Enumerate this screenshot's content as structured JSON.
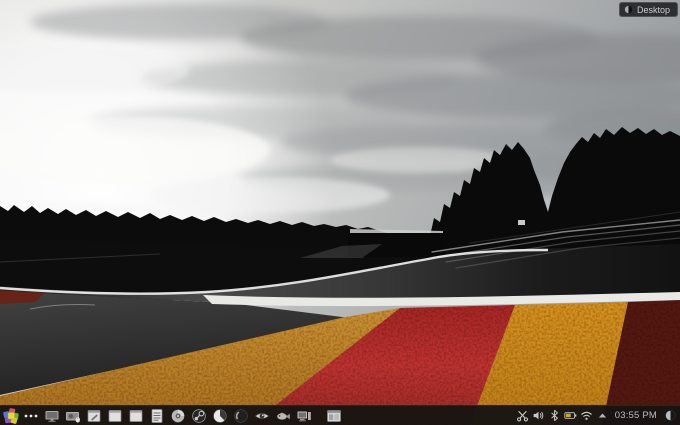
{
  "desktop_button": {
    "label": "Desktop",
    "icon": "sphere",
    "name": "desktop-toolbox-button"
  },
  "taskbar": {
    "launcher": {
      "name": "app-launcher-menu",
      "icon": "pinwheel"
    },
    "overflow": {
      "name": "overflow-menu",
      "icon": "dots"
    },
    "apps": [
      {
        "name": "display-app",
        "icon": "monitor"
      },
      {
        "name": "screen-recorder-app",
        "icon": "recorder"
      },
      {
        "name": "notes-app",
        "icon": "window-pencil"
      },
      {
        "name": "window-app-1",
        "icon": "window"
      },
      {
        "name": "window-app-2",
        "icon": "window"
      },
      {
        "name": "text-editor-app",
        "icon": "document"
      },
      {
        "name": "disc-burner-app",
        "icon": "disc"
      },
      {
        "name": "steam-app",
        "icon": "steam"
      },
      {
        "name": "browser-app",
        "icon": "globe-half"
      },
      {
        "name": "dark-browser-app",
        "icon": "dark-circle"
      },
      {
        "name": "media-viewer-app",
        "icon": "eye"
      },
      {
        "name": "fish-app",
        "icon": "fish"
      },
      {
        "name": "system-monitor-app",
        "icon": "computer"
      },
      {
        "name": "settings-app",
        "icon": "window-panels",
        "gap": "true"
      }
    ],
    "tray": [
      {
        "name": "clipboard-tray-icon",
        "icon": "scissors"
      },
      {
        "name": "volume-tray-icon",
        "icon": "speaker"
      },
      {
        "name": "bluetooth-tray-icon",
        "icon": "bluetooth"
      },
      {
        "name": "battery-tray-icon",
        "icon": "battery",
        "wide": "wide"
      },
      {
        "name": "network-tray-icon",
        "icon": "wifi"
      },
      {
        "name": "tray-expander-icon",
        "icon": "arrow-up",
        "wide": "tiny"
      }
    ],
    "clock": "03:55 PM",
    "toolbox": {
      "name": "panel-toolbox",
      "icon": "cashew"
    }
  },
  "colors": {
    "panel_bg": "#181512",
    "battery_fill": "#d6a51d",
    "kerb_red": "#b22a28",
    "kerb_yellow": "#d8921f",
    "kerb_orange": "#c98a2e",
    "kerb_maroon": "#551811",
    "clock_text": "#b9bec2"
  }
}
